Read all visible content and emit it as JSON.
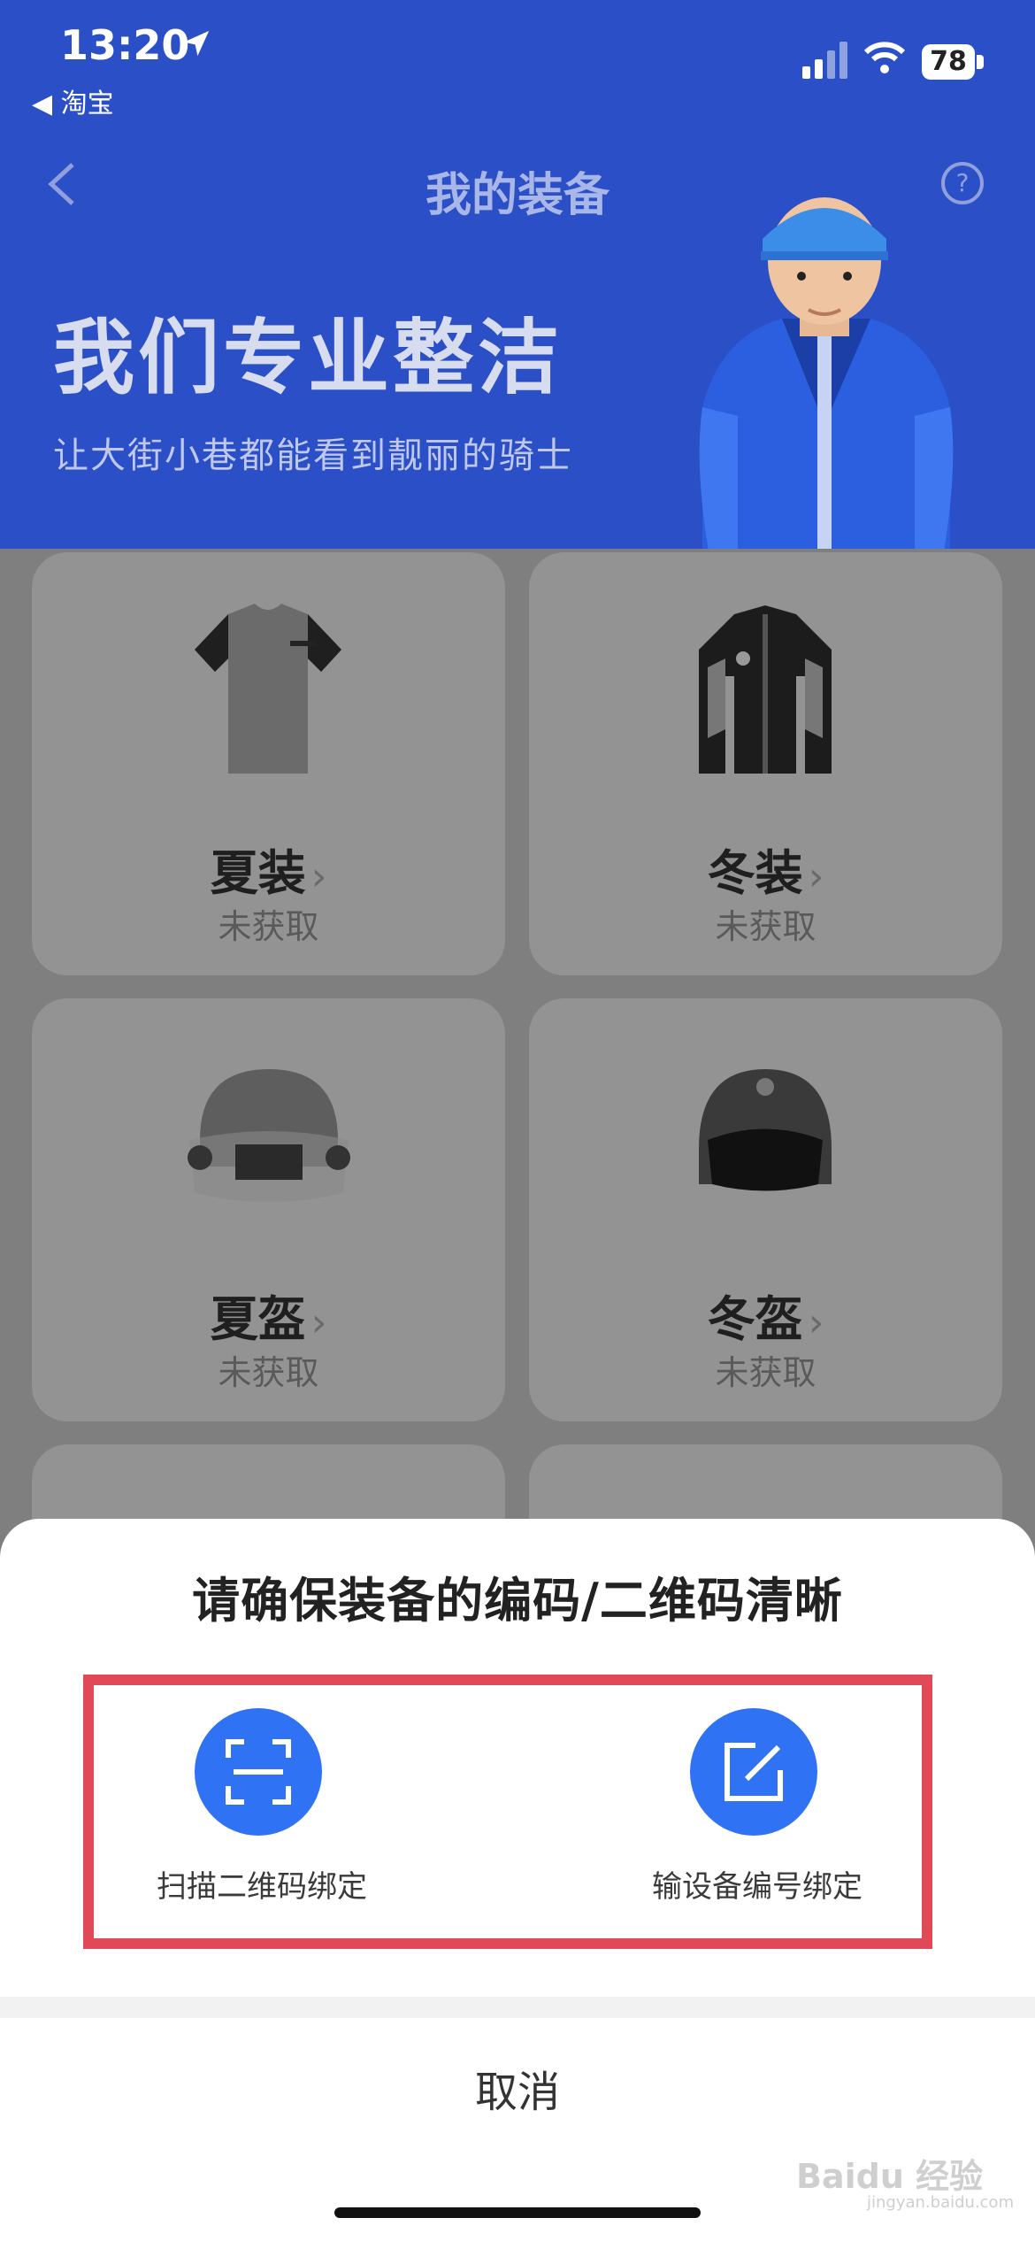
{
  "status_bar": {
    "time": "13:20",
    "back_app": "◀ 淘宝",
    "battery": "78"
  },
  "nav": {
    "title": "我的装备"
  },
  "hero": {
    "title": "我们专业整洁",
    "subtitle": "让大街小巷都能看到靓丽的骑士"
  },
  "cards": [
    {
      "name": "夏装",
      "status": "未获取"
    },
    {
      "name": "冬装",
      "status": "未获取"
    },
    {
      "name": "夏盔",
      "status": "未获取"
    },
    {
      "name": "冬盔",
      "status": "未获取"
    }
  ],
  "sheet": {
    "title": "请确保装备的编码/二维码清晰",
    "option_scan": "扫描二维码绑定",
    "option_input": "输设备编号绑定",
    "cancel": "取消"
  },
  "watermark": {
    "text": "Baidu 经验",
    "sub": "jingyan.baidu.com"
  },
  "colors": {
    "hero_blue": "#2b4fc6",
    "accent_blue": "#2f73f4",
    "highlight_red": "#e04955"
  }
}
